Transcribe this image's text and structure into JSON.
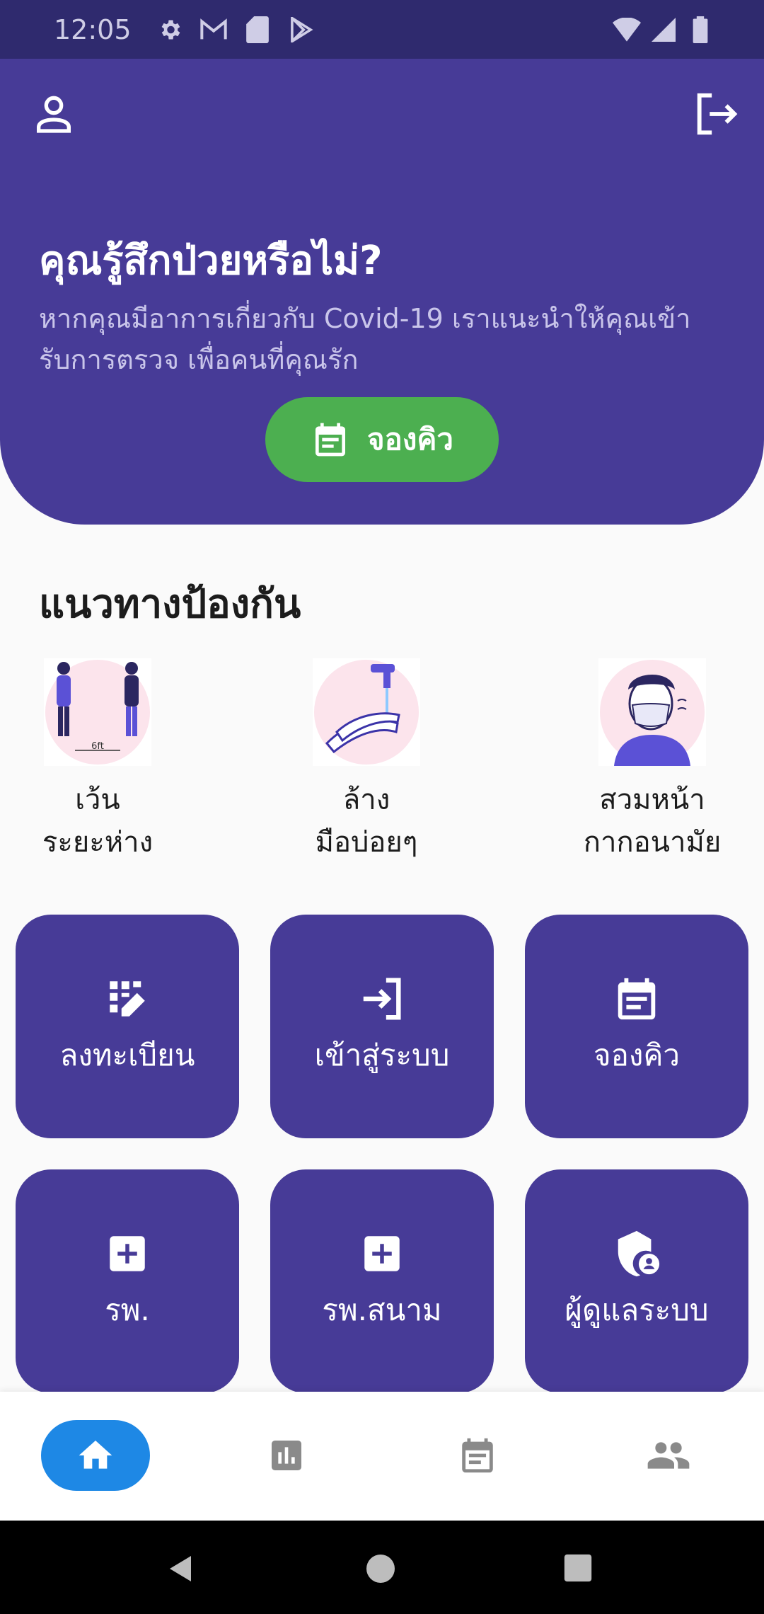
{
  "status_bar": {
    "time": "12:05",
    "icons": [
      "gear-icon",
      "gmail-icon",
      "sd-card-icon",
      "play-store-icon",
      "wifi-icon",
      "signal-icon",
      "battery-icon"
    ]
  },
  "header": {
    "profile_icon": "person-outline-icon",
    "logout_icon": "logout-icon"
  },
  "hero": {
    "title": "คุณรู้สึกป่วยหรือไม่?",
    "description": "หากคุณมีอาการเกี่ยวกับ Covid-19 เราแนะนำให้คุณเข้ารับการตรวจ เพื่อคนที่คุณรัก",
    "button_label": "จองคิว",
    "button_color": "#4caf50"
  },
  "prevention": {
    "title": "แนวทางป้องกัน",
    "items": [
      {
        "line1": "เว้น",
        "line2": "ระยะห่าง",
        "image": "social-distancing-illustration",
        "label": "6ft"
      },
      {
        "line1": "ล้าง",
        "line2": "มือบ่อยๆ",
        "image": "hand-washing-illustration"
      },
      {
        "line1": "สวมหน้า",
        "line2": "กากอนามัย",
        "image": "face-mask-illustration"
      }
    ]
  },
  "menu": [
    {
      "label": "ลงทะเบียน",
      "icon": "register-icon"
    },
    {
      "label": "เข้าสู่ระบบ",
      "icon": "login-icon"
    },
    {
      "label": "จองคิว",
      "icon": "calendar-icon"
    },
    {
      "label": "รพ.",
      "icon": "hospital-plus-icon"
    },
    {
      "label": "รพ.สนาม",
      "icon": "hospital-plus-icon"
    },
    {
      "label": "ผู้ดูแลระบบ",
      "icon": "admin-shield-icon"
    }
  ],
  "bottom_nav": {
    "items": [
      "home-icon",
      "chart-icon",
      "calendar-icon",
      "people-icon"
    ],
    "active_color": "#1e88e5"
  },
  "colors": {
    "primary": "#473b97",
    "status_bar": "#2f2a6e",
    "accent_green": "#4caf50"
  }
}
